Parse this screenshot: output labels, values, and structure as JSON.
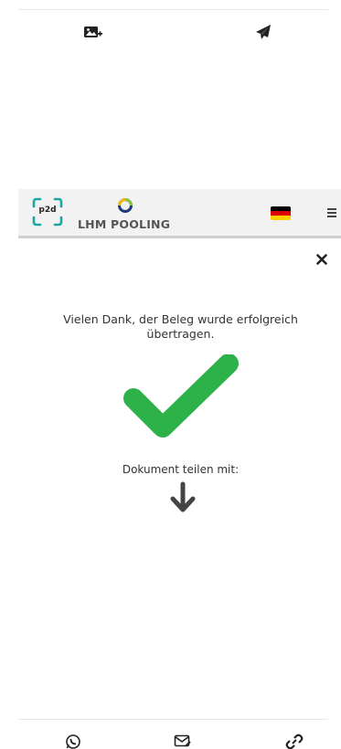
{
  "top_bar": {
    "icons": [
      "add-image-icon",
      "send-icon"
    ]
  },
  "header": {
    "logo_p2d_text": "p2d",
    "logo_brand_text": "LHM POOLING",
    "language_flag": "de",
    "flag_colors": [
      "#000000",
      "#dd0000",
      "#ffce00"
    ],
    "menu_icon": "hamburger-menu-icon"
  },
  "main": {
    "close_icon": "close-icon",
    "success_message": "Vielen Dank, der Beleg wurde erfolgreich übertragen.",
    "success_icon": "checkmark-icon",
    "success_color": "#2db24a",
    "share_label": "Dokument teilen mit:",
    "share_arrow_icon": "arrow-down-icon"
  },
  "share_bar": {
    "icons": [
      "whatsapp-icon",
      "email-icon",
      "link-icon"
    ]
  }
}
